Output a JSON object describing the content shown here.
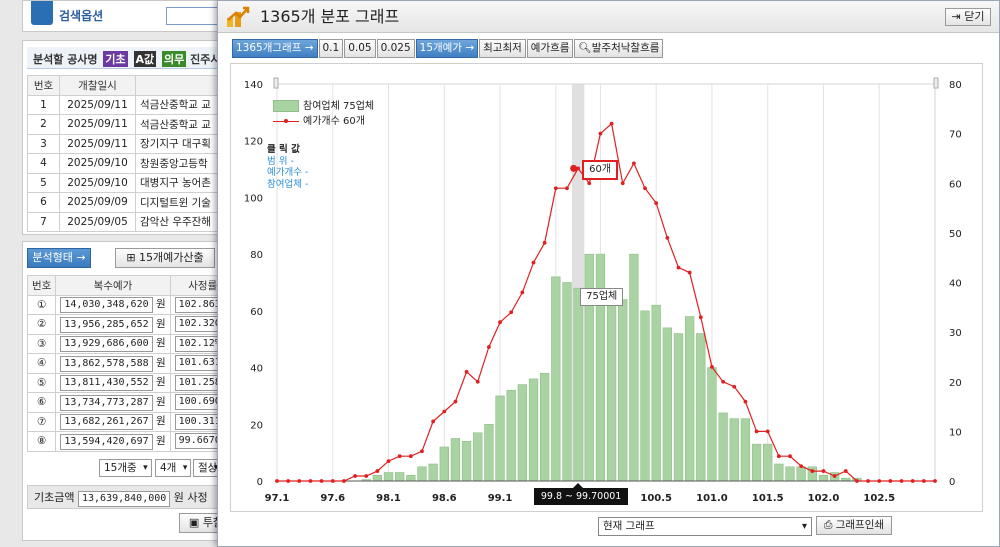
{
  "background": {
    "top_title": "검색옵션",
    "analysis_header": "분석할 공사명",
    "analysis_tags": [
      {
        "label": "기초",
        "color": "#6a3aa0"
      },
      {
        "label": "A값",
        "color": "#333333"
      },
      {
        "label": "의무",
        "color": "#3a8a2a"
      }
    ],
    "analysis_header_extra": "진주시",
    "list_columns": [
      "번호",
      "개찰일시",
      ""
    ],
    "list_rows": [
      [
        "1",
        "2025/09/11",
        "석금산중학교 교"
      ],
      [
        "2",
        "2025/09/11",
        "석금산중학교 교"
      ],
      [
        "3",
        "2025/09/11",
        "장기지구 대구획"
      ],
      [
        "4",
        "2025/09/10",
        "창원중앙고등학"
      ],
      [
        "5",
        "2025/09/10",
        "대병지구 농어촌"
      ],
      [
        "6",
        "2025/09/09",
        "디지털트윈 기술"
      ],
      [
        "7",
        "2025/09/05",
        "감악산 우주잔해"
      ]
    ],
    "analysis_type_btn": "분석형태 →",
    "calc_btn": "15개예가산출",
    "calc_columns": [
      "번호",
      "복수예가",
      "사정률"
    ],
    "calc_rows": [
      [
        "①",
        "14,030,348,620",
        "원",
        "102.863"
      ],
      [
        "②",
        "13,956,285,652",
        "원",
        "102.3200"
      ],
      [
        "③",
        "13,929,686,600",
        "원",
        "102.12%"
      ],
      [
        "④",
        "13,862,578,588",
        "원",
        "101.631"
      ],
      [
        "⑤",
        "13,811,430,552",
        "원",
        "101.2580"
      ],
      [
        "⑥",
        "13,734,773,287",
        "원",
        "100.690"
      ],
      [
        "⑦",
        "13,682,261,267",
        "원",
        "100.3110"
      ],
      [
        "⑧",
        "13,594,420,697",
        "원",
        "99.6670"
      ]
    ],
    "select_a": "15개중",
    "select_b": "4개",
    "select_c_label": "절상",
    "base_label": "기초금액",
    "base_value": "13,639,840,000",
    "base_unit": "원",
    "base_extra": "사정",
    "save_btn": "투찰"
  },
  "modal": {
    "title": "1365개 분포 그래프",
    "close_label": "닫기",
    "toolbar": [
      {
        "label": "1365개그래프 →",
        "active": true
      },
      {
        "label": "0.1",
        "active": false
      },
      {
        "label": "0.05",
        "active": false
      },
      {
        "label": "0.025",
        "active": false
      },
      {
        "label": "15개예가 →",
        "active": true
      },
      {
        "label": "최고최저",
        "active": false
      },
      {
        "label": "예가흐름",
        "active": false
      },
      {
        "label": "발주처낙찰흐름",
        "active": false,
        "icon": "magnifier-icon"
      }
    ],
    "legend": [
      {
        "label": "참여업체 75업체",
        "kind": "bar",
        "color": "#a9d3a2"
      },
      {
        "label": "예가개수 60개",
        "kind": "line",
        "color": "#e02020"
      }
    ],
    "click_info": {
      "heading": "클 릭 값",
      "rows": [
        "범    위 -",
        "예가개수 -",
        "참여업체 -"
      ]
    },
    "tooltip_line": "60개",
    "tooltip_bar": "75업체",
    "x_hover": "99.8 ~ 99.70001",
    "range_select": "현재 그래프",
    "print_label": "그래프인쇄"
  },
  "chart_data": {
    "type": "bar",
    "y_left_ticks": [
      "0",
      "20",
      "40",
      "60",
      "80",
      "100",
      "120",
      "140"
    ],
    "y_left_lim": [
      0,
      140
    ],
    "y_right_ticks": [
      "0",
      "10",
      "20",
      "30",
      "40",
      "50",
      "60",
      "70",
      "80"
    ],
    "y_right_lim": [
      0,
      80
    ],
    "x_ticks": [
      "97.1",
      "97.6",
      "98.1",
      "98.6",
      "99.1",
      "99.6",
      "100.0",
      "100.5",
      "101.0",
      "101.5",
      "102.0",
      "102.5"
    ],
    "x_start": 97.1,
    "x_end": 103.0,
    "bin_width": 0.1,
    "highlight_bin": 99.8,
    "series": [
      {
        "name": "참여업체",
        "kind": "bar",
        "color": "#a9d3a2",
        "x": [
          97.1,
          97.2,
          97.3,
          97.4,
          97.5,
          97.6,
          97.7,
          97.8,
          97.9,
          98.0,
          98.1,
          98.2,
          98.3,
          98.4,
          98.5,
          98.6,
          98.7,
          98.8,
          98.9,
          99.0,
          99.1,
          99.2,
          99.3,
          99.4,
          99.5,
          99.6,
          99.7,
          99.8,
          99.9,
          100.0,
          100.1,
          100.2,
          100.3,
          100.4,
          100.5,
          100.6,
          100.7,
          100.8,
          100.9,
          101.0,
          101.1,
          101.2,
          101.3,
          101.4,
          101.5,
          101.6,
          101.7,
          101.8,
          101.9,
          102.0,
          102.1,
          102.2,
          102.3,
          102.4,
          102.5,
          102.6,
          102.7,
          102.8,
          102.9,
          103.0
        ],
        "values": [
          0,
          0,
          0,
          0,
          0,
          0,
          0,
          0,
          0.5,
          2,
          3,
          3,
          2,
          5,
          6,
          12,
          15,
          14,
          17,
          20,
          30,
          32,
          34,
          36,
          38,
          72,
          70,
          68,
          80,
          80,
          64,
          64,
          80,
          60,
          62,
          54,
          52,
          58,
          52,
          40,
          24,
          22,
          22,
          13,
          13,
          6,
          5,
          5,
          5,
          2,
          3,
          1,
          1,
          0,
          0,
          0,
          0,
          0,
          0,
          0
        ]
      },
      {
        "name": "예가개수",
        "kind": "line",
        "color": "#e02020",
        "axis": "right",
        "x": [
          97.1,
          97.2,
          97.3,
          97.4,
          97.5,
          97.6,
          97.7,
          97.8,
          97.9,
          98.0,
          98.1,
          98.2,
          98.3,
          98.4,
          98.5,
          98.6,
          98.7,
          98.8,
          98.9,
          99.0,
          99.1,
          99.2,
          99.3,
          99.4,
          99.5,
          99.6,
          99.7,
          99.8,
          99.9,
          100.0,
          100.1,
          100.2,
          100.3,
          100.4,
          100.5,
          100.6,
          100.7,
          100.8,
          100.9,
          101.0,
          101.1,
          101.2,
          101.3,
          101.4,
          101.5,
          101.6,
          101.7,
          101.8,
          101.9,
          102.0,
          102.1,
          102.2,
          102.3,
          102.4,
          102.5,
          102.6,
          102.7,
          102.8,
          102.9,
          103.0
        ],
        "values": [
          0,
          0,
          0,
          0,
          0,
          0,
          0,
          1,
          1,
          2,
          4,
          5,
          5,
          6,
          12,
          14,
          16,
          22,
          20,
          27,
          32,
          34,
          38,
          44,
          48,
          59,
          59,
          63,
          60,
          70,
          72,
          60,
          64,
          59,
          56,
          49,
          43,
          42,
          33,
          23,
          20,
          19,
          16,
          10,
          10,
          5,
          5,
          3,
          2,
          2,
          1,
          2,
          0,
          0,
          0,
          0,
          0,
          0,
          0,
          0
        ]
      }
    ]
  }
}
